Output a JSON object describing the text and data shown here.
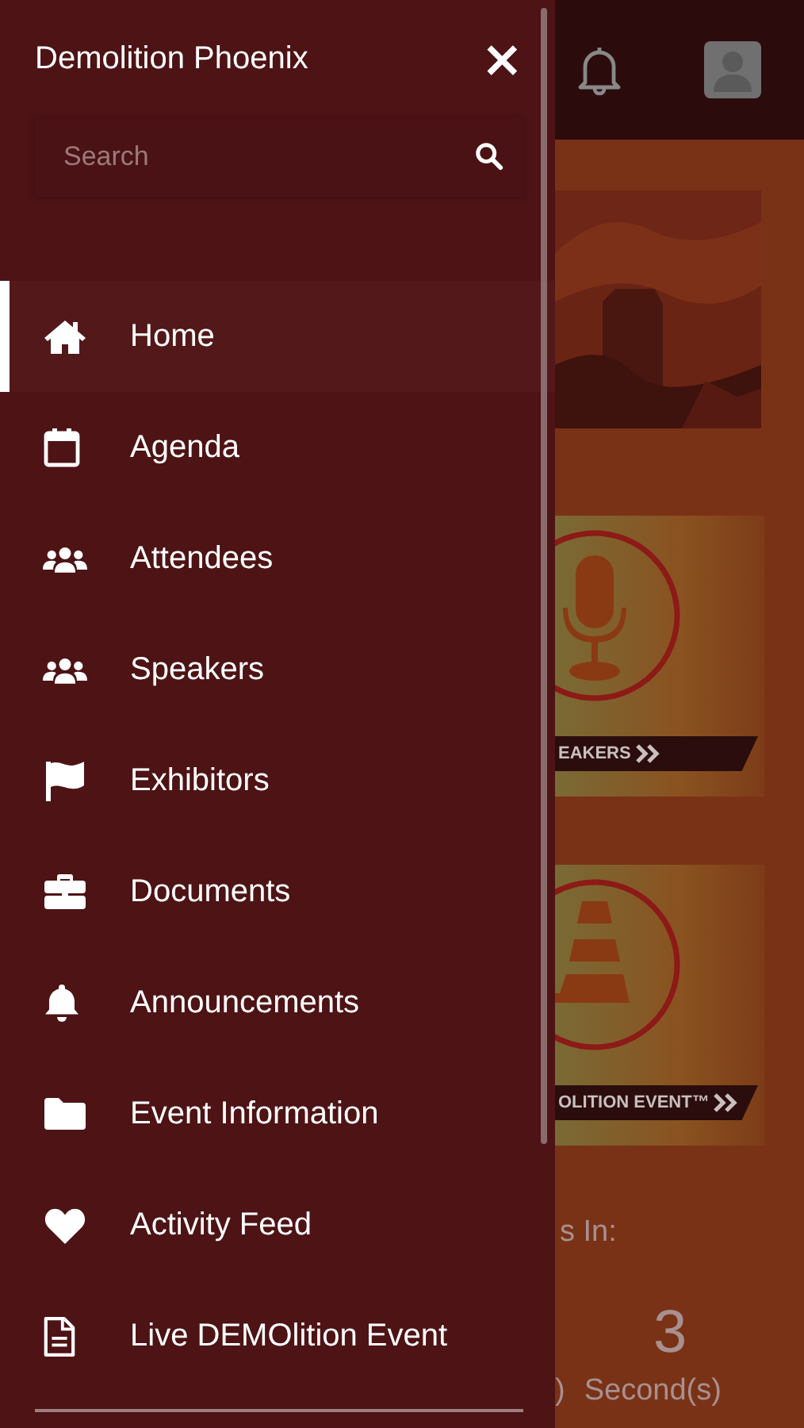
{
  "drawer": {
    "title": "Demolition Phoenix",
    "close": "×",
    "search": {
      "placeholder": "Search"
    },
    "items": [
      {
        "label": "Home",
        "selected": true
      },
      {
        "label": "Agenda",
        "selected": false
      },
      {
        "label": "Attendees",
        "selected": false
      },
      {
        "label": "Speakers",
        "selected": false
      },
      {
        "label": "Exhibitors",
        "selected": false
      },
      {
        "label": "Documents",
        "selected": false
      },
      {
        "label": "Announcements",
        "selected": false
      },
      {
        "label": "Event Information",
        "selected": false
      },
      {
        "label": "Activity Feed",
        "selected": false
      },
      {
        "label": "Live DEMOlition Event",
        "selected": false
      }
    ]
  },
  "page": {
    "tiles": [
      {
        "label": "EAKERS"
      },
      {
        "label": "OLITION EVENT™"
      }
    ],
    "countdown": {
      "heading": "s In:",
      "value": "3",
      "units": [
        ")",
        "Second(s)"
      ]
    }
  }
}
